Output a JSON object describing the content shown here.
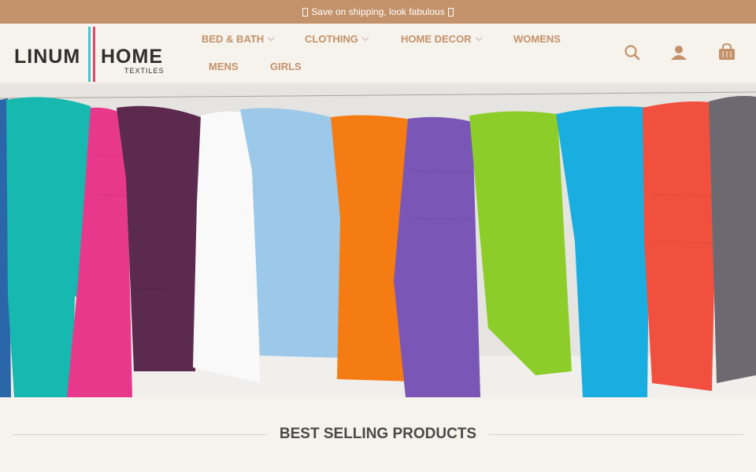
{
  "topbar": {
    "promo_text": "Save on shipping, look fabulous",
    "glyph_left": "",
    "glyph_right": ""
  },
  "logo": {
    "word1": "LINUM",
    "word2": "HOME",
    "word3": "TEXTILES",
    "colors": {
      "bar1": "#47c6d2",
      "bar2": "#e04a6a"
    }
  },
  "nav": {
    "items": [
      {
        "label": "BED & BATH",
        "has_dropdown": true
      },
      {
        "label": "CLOTHING",
        "has_dropdown": true
      },
      {
        "label": "HOME DECOR",
        "has_dropdown": true
      },
      {
        "label": "WOMENS",
        "has_dropdown": false
      },
      {
        "label": "MENS",
        "has_dropdown": false
      },
      {
        "label": "GIRLS",
        "has_dropdown": false
      }
    ]
  },
  "icons": {
    "search": "search-icon",
    "account": "account-icon",
    "cart": "cart-icon"
  },
  "hero": {
    "image": "colorful-scarves-on-line",
    "scarf_colors": [
      "#17b8b0",
      "#e8388c",
      "#5b2a4e",
      "#ffffff",
      "#9cc8ea",
      "#f57c12",
      "#7a56b7",
      "#8ccd2a",
      "#1aaee0",
      "#f2503e",
      "#6c6a70"
    ]
  },
  "section": {
    "title": "BEST SELLING PRODUCTS"
  },
  "theme": {
    "accent": "#c4926a",
    "background": "#f6f2ec",
    "text_dark": "#4a4a4a"
  }
}
